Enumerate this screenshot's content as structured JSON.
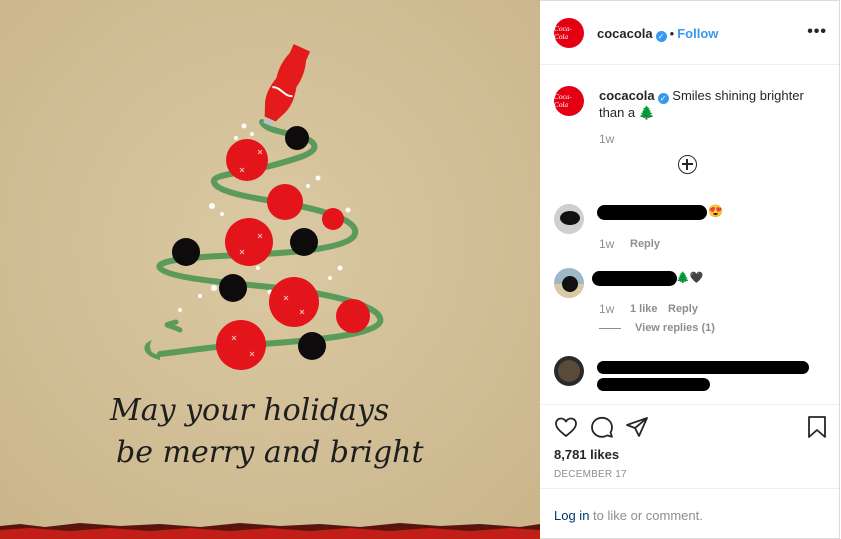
{
  "post": {
    "image_text_line1": "May your holidays",
    "image_text_line2": "be merry and bright"
  },
  "brand": {
    "logo_text": "Coca-Cola",
    "accent": "#e40012",
    "link_color": "#3897f0"
  },
  "header": {
    "username": "cocacola",
    "separator": "•",
    "follow_label": "Follow",
    "more_icon": "more-horizontal-icon"
  },
  "caption": {
    "username": "cocacola",
    "text": "Smiles shining brighter than a 🌲",
    "time": "1w"
  },
  "comments": [
    {
      "emoji": "😍",
      "time": "1w",
      "reply_label": "Reply"
    },
    {
      "emoji": "🌲🖤",
      "time": "1w",
      "likes": "1 like",
      "reply_label": "Reply",
      "view_replies": "View replies (1)"
    },
    {
      "emoji": ""
    }
  ],
  "actions": {
    "likes": "8,781 likes",
    "date": "DECEMBER 17",
    "icons": [
      "heart-icon",
      "comment-icon",
      "share-icon",
      "bookmark-icon"
    ]
  },
  "login": {
    "link": "Log in",
    "rest": " to like or comment."
  }
}
